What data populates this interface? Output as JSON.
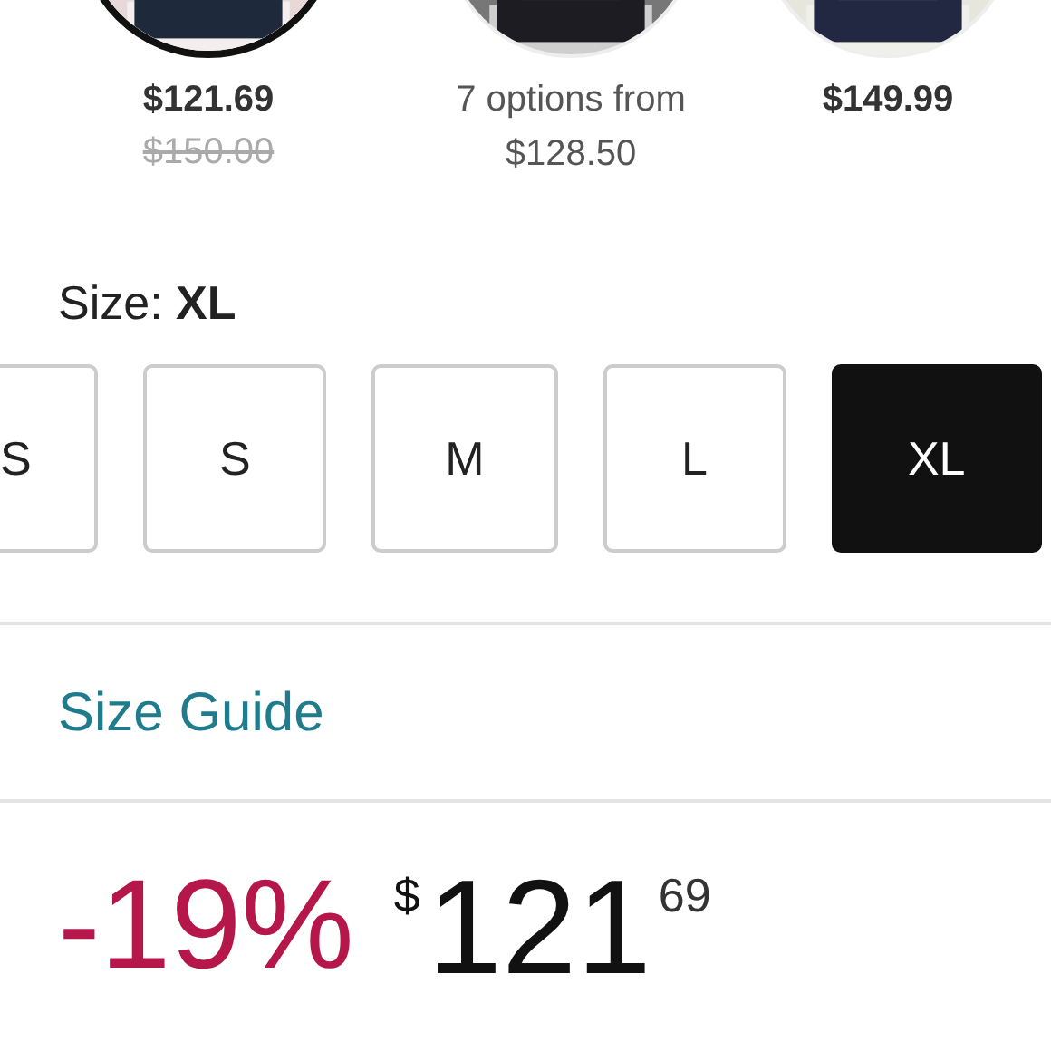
{
  "swatches": [
    {
      "selected": true,
      "price": "$121.69",
      "old_price": "$150.00"
    },
    {
      "selected": false,
      "price_lines": [
        "7 options from",
        "$128.50"
      ]
    },
    {
      "selected": false,
      "price": "$149.99"
    }
  ],
  "size_label": "Size: ",
  "size_value": "XL",
  "sizes": [
    {
      "label": "S",
      "selected": false,
      "partial": true
    },
    {
      "label": "S",
      "selected": false
    },
    {
      "label": "M",
      "selected": false
    },
    {
      "label": "L",
      "selected": false
    },
    {
      "label": "XL",
      "selected": true
    }
  ],
  "size_guide": "Size Guide",
  "discount": "-19%",
  "price": {
    "currency": "$",
    "whole": "121",
    "fraction": "69"
  }
}
